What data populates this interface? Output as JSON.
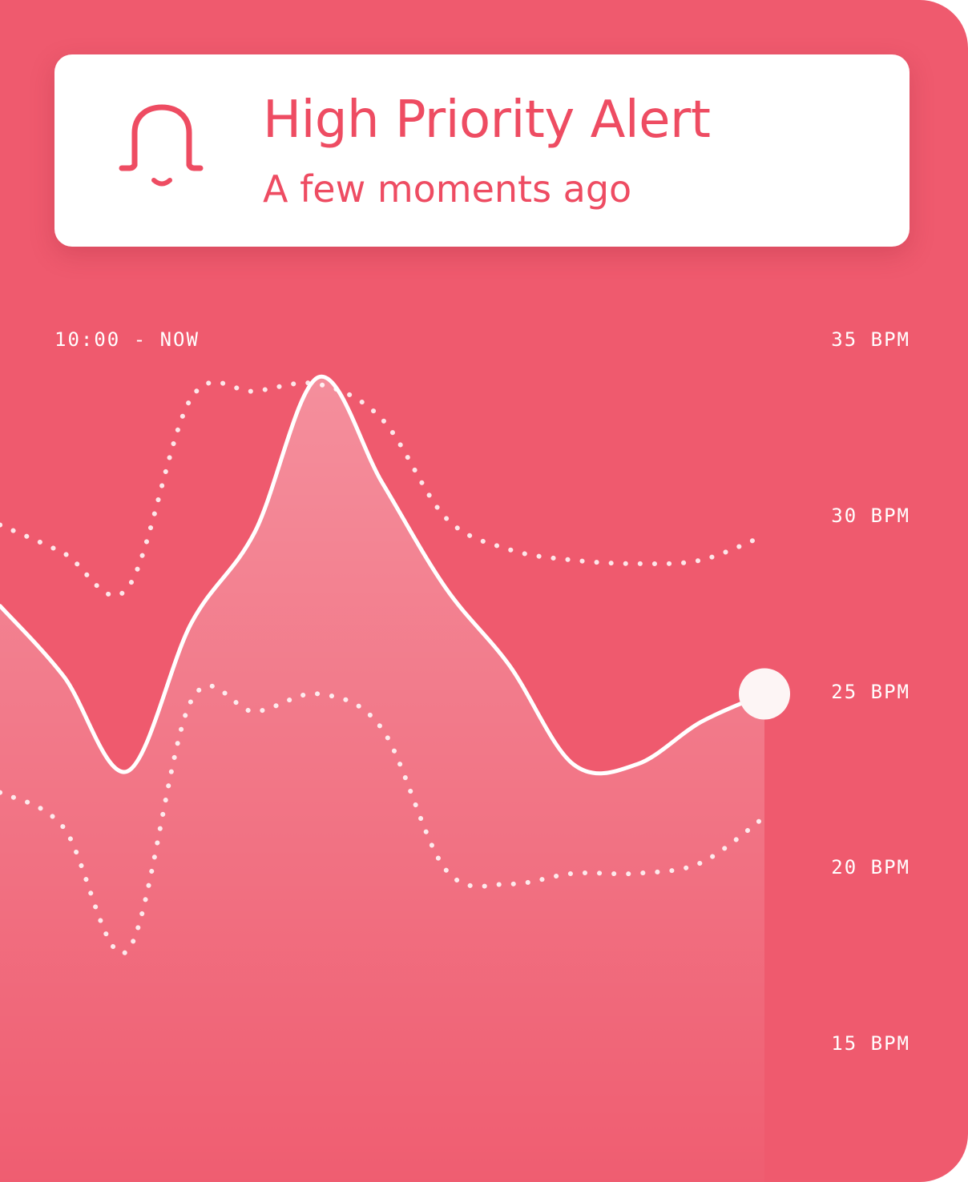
{
  "alert": {
    "icon": "bell-icon",
    "title": "High Priority Alert",
    "time": "A few moments ago"
  },
  "chart_data": {
    "type": "line",
    "range_label": "10:00 - NOW",
    "y_ticks": [
      "35 BPM",
      "30 BPM",
      "25 BPM",
      "20 BPM",
      "15 BPM"
    ],
    "ylim": [
      15,
      35
    ],
    "x": [
      0,
      1,
      2,
      3,
      4,
      5,
      6,
      7,
      8,
      9,
      10,
      11,
      12
    ],
    "series": [
      {
        "style": "solid-filled",
        "values": [
          27.5,
          25.5,
          22.8,
          27.0,
          29.6,
          34.0,
          31.0,
          28.0,
          25.8,
          23.0,
          23.0,
          24.2,
          25.0
        ]
      },
      {
        "style": "dotted",
        "values": [
          29.8,
          29.0,
          28.0,
          33.4,
          33.6,
          33.8,
          32.8,
          30.0,
          29.1,
          28.8,
          28.7,
          28.8,
          29.5
        ]
      },
      {
        "style": "dotted",
        "values": [
          22.2,
          21.2,
          17.7,
          24.8,
          24.5,
          25.0,
          24.0,
          20.0,
          19.6,
          19.9,
          19.9,
          20.2,
          21.5
        ]
      }
    ],
    "colors": {
      "background": "#ef5a6e",
      "line": "#ffffff",
      "accent": "#ee4c62"
    }
  }
}
